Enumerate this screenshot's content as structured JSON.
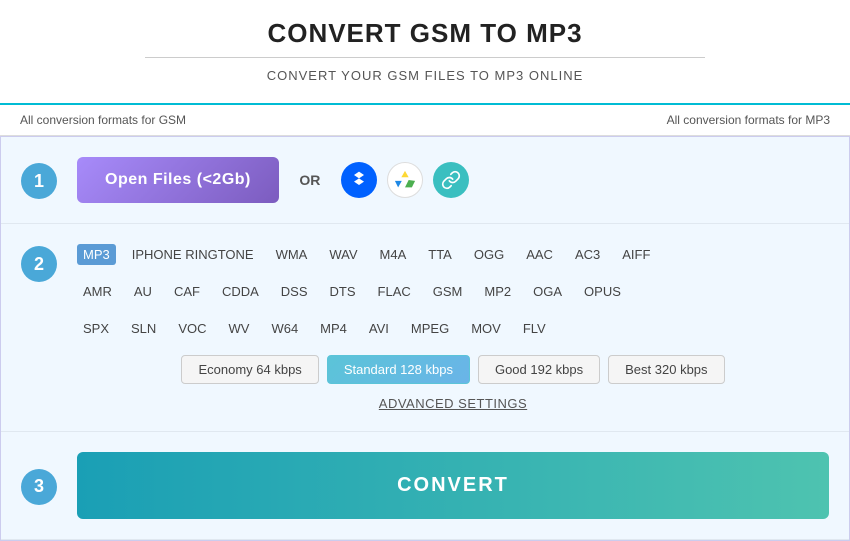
{
  "header": {
    "title": "CONVERT GSM TO MP3",
    "subtitle": "CONVERT YOUR GSM FILES TO MP3 ONLINE",
    "tab_left": "All conversion formats for GSM",
    "tab_right": "All conversion formats for MP3"
  },
  "steps": {
    "step1": {
      "number": "1",
      "open_btn": "Open Files (<2Gb)",
      "or_text": "OR"
    },
    "step2": {
      "number": "2",
      "formats_row1": [
        "MP3",
        "IPHONE RINGTONE",
        "WMA",
        "WAV",
        "M4A",
        "TTA",
        "OGG",
        "AAC",
        "AC3",
        "AIFF"
      ],
      "formats_row2": [
        "AMR",
        "AU",
        "CAF",
        "CDDA",
        "DSS",
        "DTS",
        "FLAC",
        "GSM",
        "MP2",
        "OGA",
        "OPUS"
      ],
      "formats_row3": [
        "SPX",
        "SLN",
        "VOC",
        "WV",
        "W64",
        "MP4",
        "AVI",
        "MPEG",
        "MOV",
        "FLV"
      ],
      "qualities": [
        {
          "label": "Economy 64 kbps",
          "active": false
        },
        {
          "label": "Standard 128 kbps",
          "active": true
        },
        {
          "label": "Good 192 kbps",
          "active": false
        },
        {
          "label": "Best 320 kbps",
          "active": false
        }
      ],
      "advanced_settings": "ADVANCED SETTINGS"
    },
    "step3": {
      "number": "3",
      "convert_btn": "CONVERT"
    }
  }
}
